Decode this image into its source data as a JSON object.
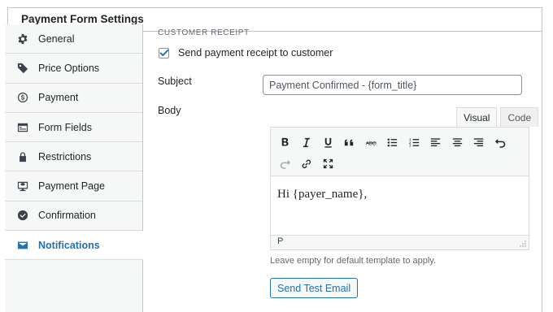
{
  "panel": {
    "title": "Payment Form Settings"
  },
  "sidebar": {
    "items": [
      {
        "label": "General",
        "icon": "gear-icon"
      },
      {
        "label": "Price Options",
        "icon": "tag-icon"
      },
      {
        "label": "Payment",
        "icon": "dollar-circle-icon"
      },
      {
        "label": "Form Fields",
        "icon": "form-fields-icon"
      },
      {
        "label": "Restrictions",
        "icon": "lock-icon"
      },
      {
        "label": "Payment Page",
        "icon": "monitor-icon"
      },
      {
        "label": "Confirmation",
        "icon": "check-circle-icon"
      },
      {
        "label": "Notifications",
        "icon": "envelope-icon",
        "active": true
      }
    ]
  },
  "content": {
    "section_title": "CUSTOMER RECEIPT",
    "checkbox": {
      "label": "Send payment receipt to customer",
      "checked": true
    },
    "subject": {
      "label": "Subject",
      "value": "Payment Confirmed - {form_title}"
    },
    "body": {
      "label": "Body",
      "tabs": [
        "Visual",
        "Code"
      ],
      "active_tab": "Visual",
      "text": "Hi {payer_name},",
      "status_path": "P"
    },
    "hint": "Leave empty for default template to apply.",
    "test_button": "Send Test Email"
  },
  "colors": {
    "accent": "#2271b1",
    "border": "#c3c4c7",
    "sidebar_bg": "#f6f7f7"
  }
}
